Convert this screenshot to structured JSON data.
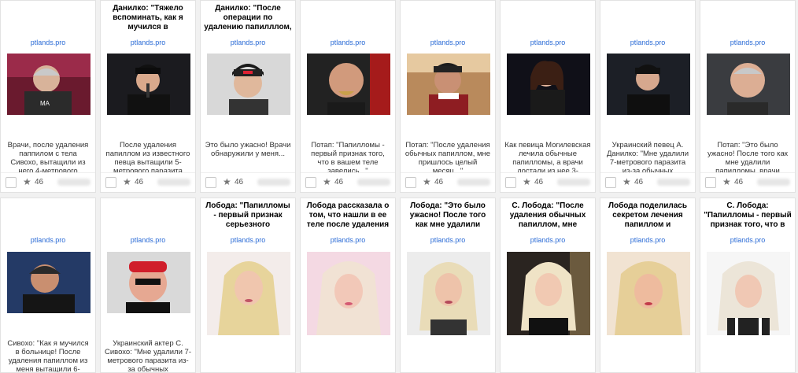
{
  "colors": {
    "link": "#2a6bd6",
    "text": "#333333",
    "title": "#000000"
  },
  "row1": [
    {
      "title": "",
      "domain": "ptlands.pro",
      "desc": "Врачи, после удаления паппилом с тела Сивохо, вытащили из него 4-метрового",
      "count": "46",
      "star": "★"
    },
    {
      "title": "Данилко: \"Тяжело вспоминать, как я мучился в",
      "domain": "ptlands.pro",
      "desc": "После удаления папиллом из известного певца вытащили 5-метрового паразита",
      "count": "46",
      "star": "★"
    },
    {
      "title": "Данилко: \"После операции по удалению папилллом,",
      "domain": "ptlands.pro",
      "desc": "Это было ужасно! Врачи обнаружили у меня...",
      "count": "46",
      "star": "★"
    },
    {
      "title": "",
      "domain": "ptlands.pro",
      "desc": "Потап: \"Папилломы - первый признак того, что в вашем теле завелись...\"",
      "count": "46",
      "star": "★"
    },
    {
      "title": "",
      "domain": "ptlands.pro",
      "desc": "Потап: \"После удаления обычных папиллом, мне пришлось целый месяц...\"",
      "count": "46",
      "star": "★"
    },
    {
      "title": "",
      "domain": "ptlands.pro",
      "desc": "Как певица Могилевская лечила обычные папилломы, а врачи достали из нее 3-",
      "count": "46",
      "star": "★"
    },
    {
      "title": "",
      "domain": "ptlands.pro",
      "desc": "Украинский певец А. Данилко: \"Мне удалили 7-метрового паразита из-за обычных",
      "count": "46",
      "star": "★"
    },
    {
      "title": "",
      "domain": "ptlands.pro",
      "desc": "Потап: \"Это было ужасно! После того как мне удалили папилломы, врачи",
      "count": "46",
      "star": "★"
    }
  ],
  "row2": [
    {
      "title": "",
      "domain": "ptlands.pro",
      "desc": "Сивохо: \"Как я мучился в больнице! После удаления папиллом из меня вытащили 6-"
    },
    {
      "title": "",
      "domain": "ptlands.pro",
      "desc": "Украинский актер С. Сивохо: \"Мне удалили 7-метрового паразита из-за обычных"
    },
    {
      "title": "Лобода: \"Папилломы - первый признак серьезного",
      "domain": "ptlands.pro",
      "desc": ""
    },
    {
      "title": "Лобода рассказала о том, что нашли в ее теле после удаления",
      "domain": "ptlands.pro",
      "desc": ""
    },
    {
      "title": "Лобода: \"Это было ужасно! После того как мне удалили",
      "domain": "ptlands.pro",
      "desc": ""
    },
    {
      "title": "С. Лобода: \"После удаления обычных папиллом, мне",
      "domain": "ptlands.pro",
      "desc": ""
    },
    {
      "title": "Лобода поделилась секретом лечения папиллом и",
      "domain": "ptlands.pro",
      "desc": ""
    },
    {
      "title": "С. Лобода: \"Папилломы - первый признак того, что в",
      "domain": "ptlands.pro",
      "desc": ""
    }
  ]
}
